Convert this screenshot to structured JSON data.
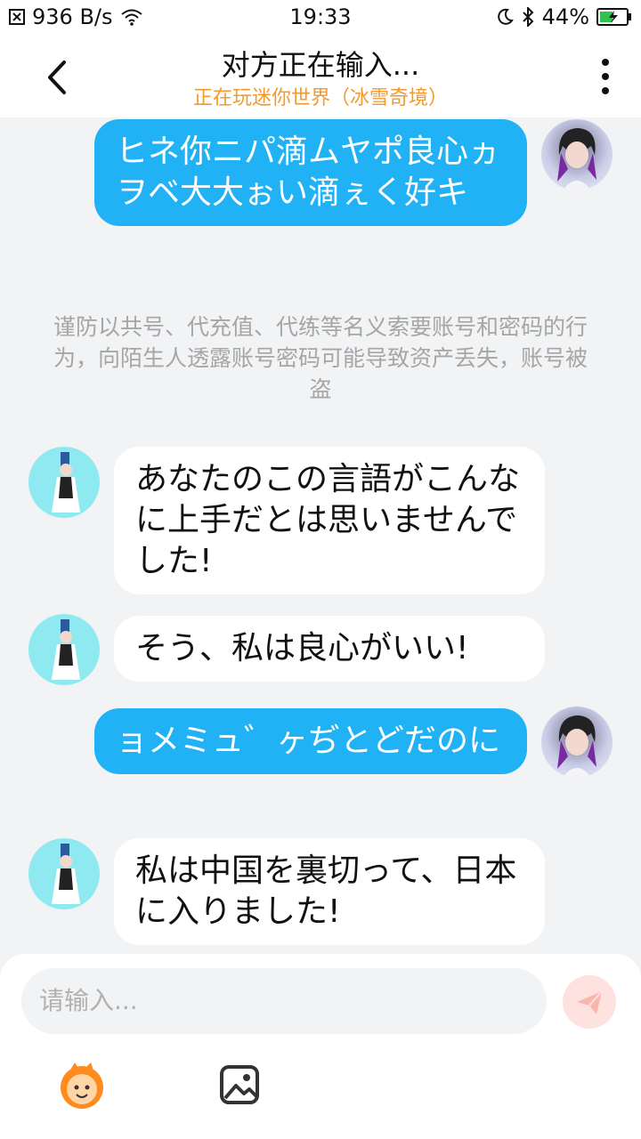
{
  "status": {
    "network_speed": "936 B/s",
    "time": "19:33",
    "battery": "44%"
  },
  "header": {
    "title": "对方正在输入...",
    "subtitle": "正在玩迷你世界（冰雪奇境）"
  },
  "messages": [
    {
      "side": "me",
      "text": "ヒネ你ニパ滴ムヤポ良心ヵヲベ大大ぉい滴ぇく好キ"
    },
    {
      "side": "system",
      "text": "谨防以共号、代充值、代练等名义索要账号和密码的行为，向陌生人透露账号密码可能导致资产丢失，账号被盗"
    },
    {
      "side": "other",
      "text": "あなたのこの言語がこんなに上手だとは思いませんでした!"
    },
    {
      "side": "other",
      "text": "そう、私は良心がいい!"
    },
    {
      "side": "me",
      "text": "ョメミュ゛ヶぢとどだのに"
    },
    {
      "side": "other",
      "text": "私は中国を裏切って、日本に入りました!"
    }
  ],
  "input": {
    "placeholder": "请输入..."
  },
  "colors": {
    "my_bubble": "#20b2f5",
    "other_bubble": "#ffffff",
    "subtitle": "#f39a2d",
    "notice": "#a6a6a6"
  },
  "icons": [
    "back-icon",
    "more-icon",
    "send-icon",
    "emoji-icon",
    "image-icon",
    "wifi-icon",
    "moon-icon",
    "bluetooth-icon",
    "battery-icon"
  ]
}
